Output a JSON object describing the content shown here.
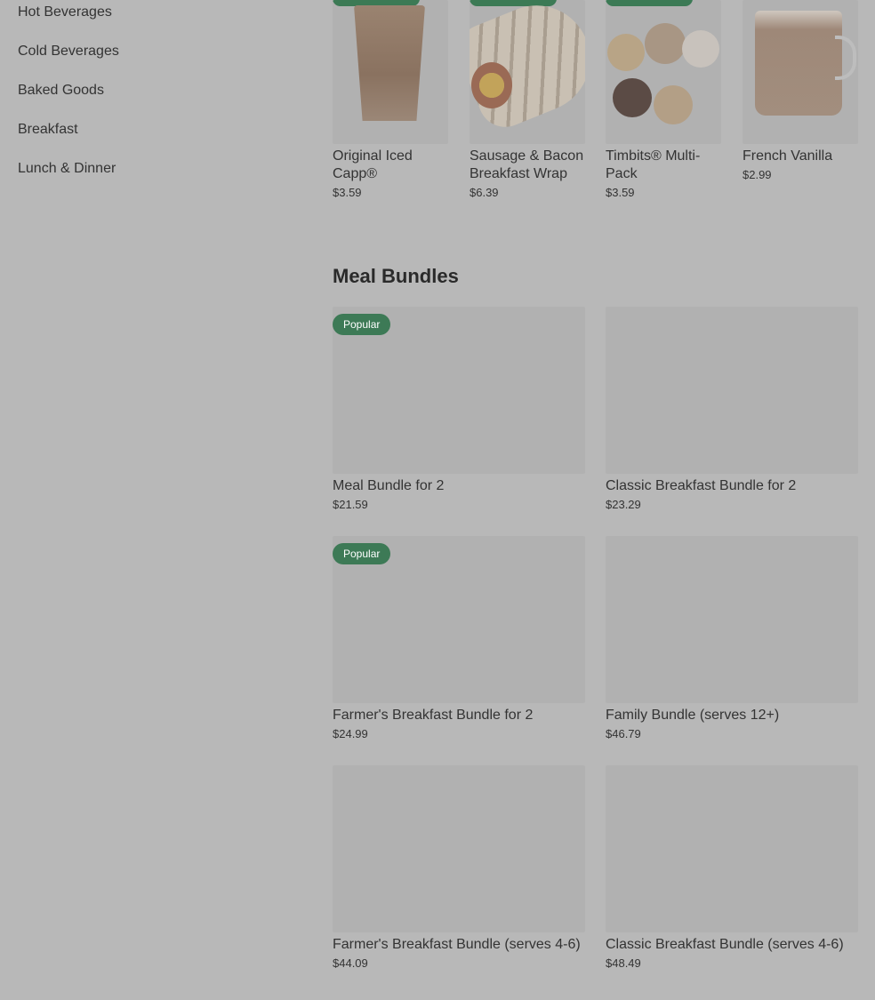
{
  "colors": {
    "background": "#b8b8b8",
    "badge": "#3d7a56",
    "text": "#333333"
  },
  "sidebar": {
    "items": [
      {
        "label": "Hot Beverages"
      },
      {
        "label": "Cold Beverages"
      },
      {
        "label": "Baked Goods"
      },
      {
        "label": "Breakfast"
      },
      {
        "label": "Lunch & Dinner"
      }
    ]
  },
  "featured": {
    "products": [
      {
        "name": "Original Iced Capp®",
        "price": "$3.59",
        "image_icon": "iced-capp-photo"
      },
      {
        "name": "Sausage & Bacon Breakfast Wrap",
        "price": "$6.39",
        "image_icon": "breakfast-wrap-photo"
      },
      {
        "name": "Timbits® Multi-Pack",
        "price": "$3.59",
        "image_icon": "timbits-photo"
      },
      {
        "name": "French Vanilla",
        "price": "$2.99",
        "image_icon": "french-vanilla-mug-photo"
      }
    ]
  },
  "meal_bundles": {
    "title": "Meal Bundles",
    "items": [
      {
        "name": "Meal Bundle for 2",
        "price": "$21.59",
        "badge": "Popular"
      },
      {
        "name": "Classic Breakfast Bundle for 2",
        "price": "$23.29",
        "badge": ""
      },
      {
        "name": "Farmer's Breakfast Bundle for 2",
        "price": "$24.99",
        "badge": "Popular"
      },
      {
        "name": "Family Bundle (serves 12+)",
        "price": "$46.79",
        "badge": ""
      },
      {
        "name": "Farmer's Breakfast Bundle (serves 4-6)",
        "price": "$44.09",
        "badge": ""
      },
      {
        "name": "Classic Breakfast Bundle (serves 4-6)",
        "price": "$48.49",
        "badge": ""
      }
    ]
  }
}
